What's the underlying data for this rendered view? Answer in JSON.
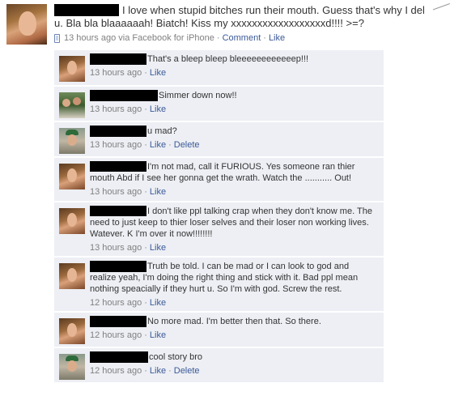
{
  "post": {
    "text": "I love when stupid bitches run their mouth. Guess that's why I del u. Bla bla blaaaaaah! Biatch! Kiss my xxxxxxxxxxxxxxxxxxd!!!! >=?",
    "time": "13 hours ago via Facebook for iPhone",
    "comment_link": "Comment",
    "like_link": "Like"
  },
  "comments": [
    {
      "text": "That's a bleep bleep bleeeeeeeeeeeep!!!",
      "time": "13 hours ago",
      "like": "Like"
    },
    {
      "text": "Simmer down now!!",
      "time": "13 hours ago",
      "like": "Like"
    },
    {
      "text": "u mad?",
      "time": "13 hours ago",
      "like": "Like",
      "delete": "Delete"
    },
    {
      "text": "I'm not mad, call it FURIOUS. Yes someone ran thier mouth Abd if I see her gonna get the wrath. Watch the ........... Out!",
      "time": "13 hours ago",
      "like": "Like"
    },
    {
      "text": "I don't like ppl talking crap when they don't know me. The need to just keep to thier loser selves and their loser non working lives. Watever. K I'm over it now!!!!!!!!",
      "time": "13 hours ago",
      "like": "Like"
    },
    {
      "text": "Truth be told. I can be mad or I can look to god and realize yeah, I'm doing the right thing and stick with it. Bad ppl mean nothing speacially if they hurt u. So I'm with god. Screw the rest.",
      "time": "12 hours ago",
      "like": "Like"
    },
    {
      "text": "No more mad. I'm better then that. So there.",
      "time": "12 hours ago",
      "like": "Like"
    },
    {
      "text": "cool story bro",
      "time": "12 hours ago",
      "like": "Like",
      "delete": "Delete"
    }
  ]
}
